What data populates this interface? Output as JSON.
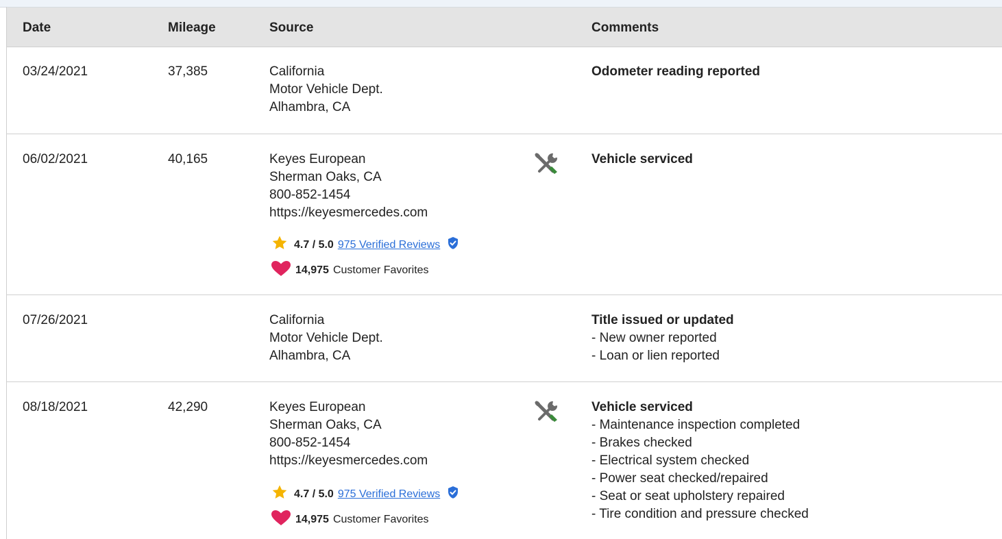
{
  "columns": {
    "date": "Date",
    "mileage": "Mileage",
    "source": "Source",
    "comments": "Comments"
  },
  "rows": [
    {
      "date": "03/24/2021",
      "mileage": "37,385",
      "source": [
        "California",
        "Motor Vehicle Dept.",
        "Alhambra, CA"
      ],
      "comment_title": "Odometer reading reported",
      "comment_items": []
    },
    {
      "date": "06/02/2021",
      "mileage": "40,165",
      "source": [
        "Keyes European",
        "Sherman Oaks, CA",
        "800-852-1454",
        "https://keyesmercedes.com"
      ],
      "rating": "4.7 / 5.0",
      "reviews_link": "975 Verified Reviews",
      "favorites_count": "14,975",
      "favorites_label": "Customer Favorites",
      "service_icon": "wrench-screwdriver-icon",
      "comment_title": "Vehicle serviced",
      "comment_items": []
    },
    {
      "date": "07/26/2021",
      "mileage": "",
      "source": [
        "California",
        "Motor Vehicle Dept.",
        "Alhambra, CA"
      ],
      "comment_title": "Title issued or updated",
      "comment_items": [
        "- New owner reported",
        "- Loan or lien reported"
      ]
    },
    {
      "date": "08/18/2021",
      "mileage": "42,290",
      "source": [
        "Keyes European",
        "Sherman Oaks, CA",
        "800-852-1454",
        "https://keyesmercedes.com"
      ],
      "rating": "4.7 / 5.0",
      "reviews_link": "975 Verified Reviews",
      "favorites_count": "14,975",
      "favorites_label": "Customer Favorites",
      "service_icon": "wrench-screwdriver-icon",
      "comment_title": "Vehicle serviced",
      "comment_items": [
        "- Maintenance inspection completed",
        "- Brakes checked",
        "- Electrical system checked",
        "- Power seat checked/repaired",
        "- Seat or seat upholstery repaired",
        "- Tire condition and pressure checked"
      ]
    }
  ],
  "colors": {
    "header_bg": "#e4e4e4",
    "link": "#2a6ed8",
    "star": "#f5b400",
    "heart": "#e0245e",
    "verified_badge": "#2a6ed8",
    "wrench_gray": "#6b6b6b",
    "screwdriver_green": "#3a8a3a"
  }
}
